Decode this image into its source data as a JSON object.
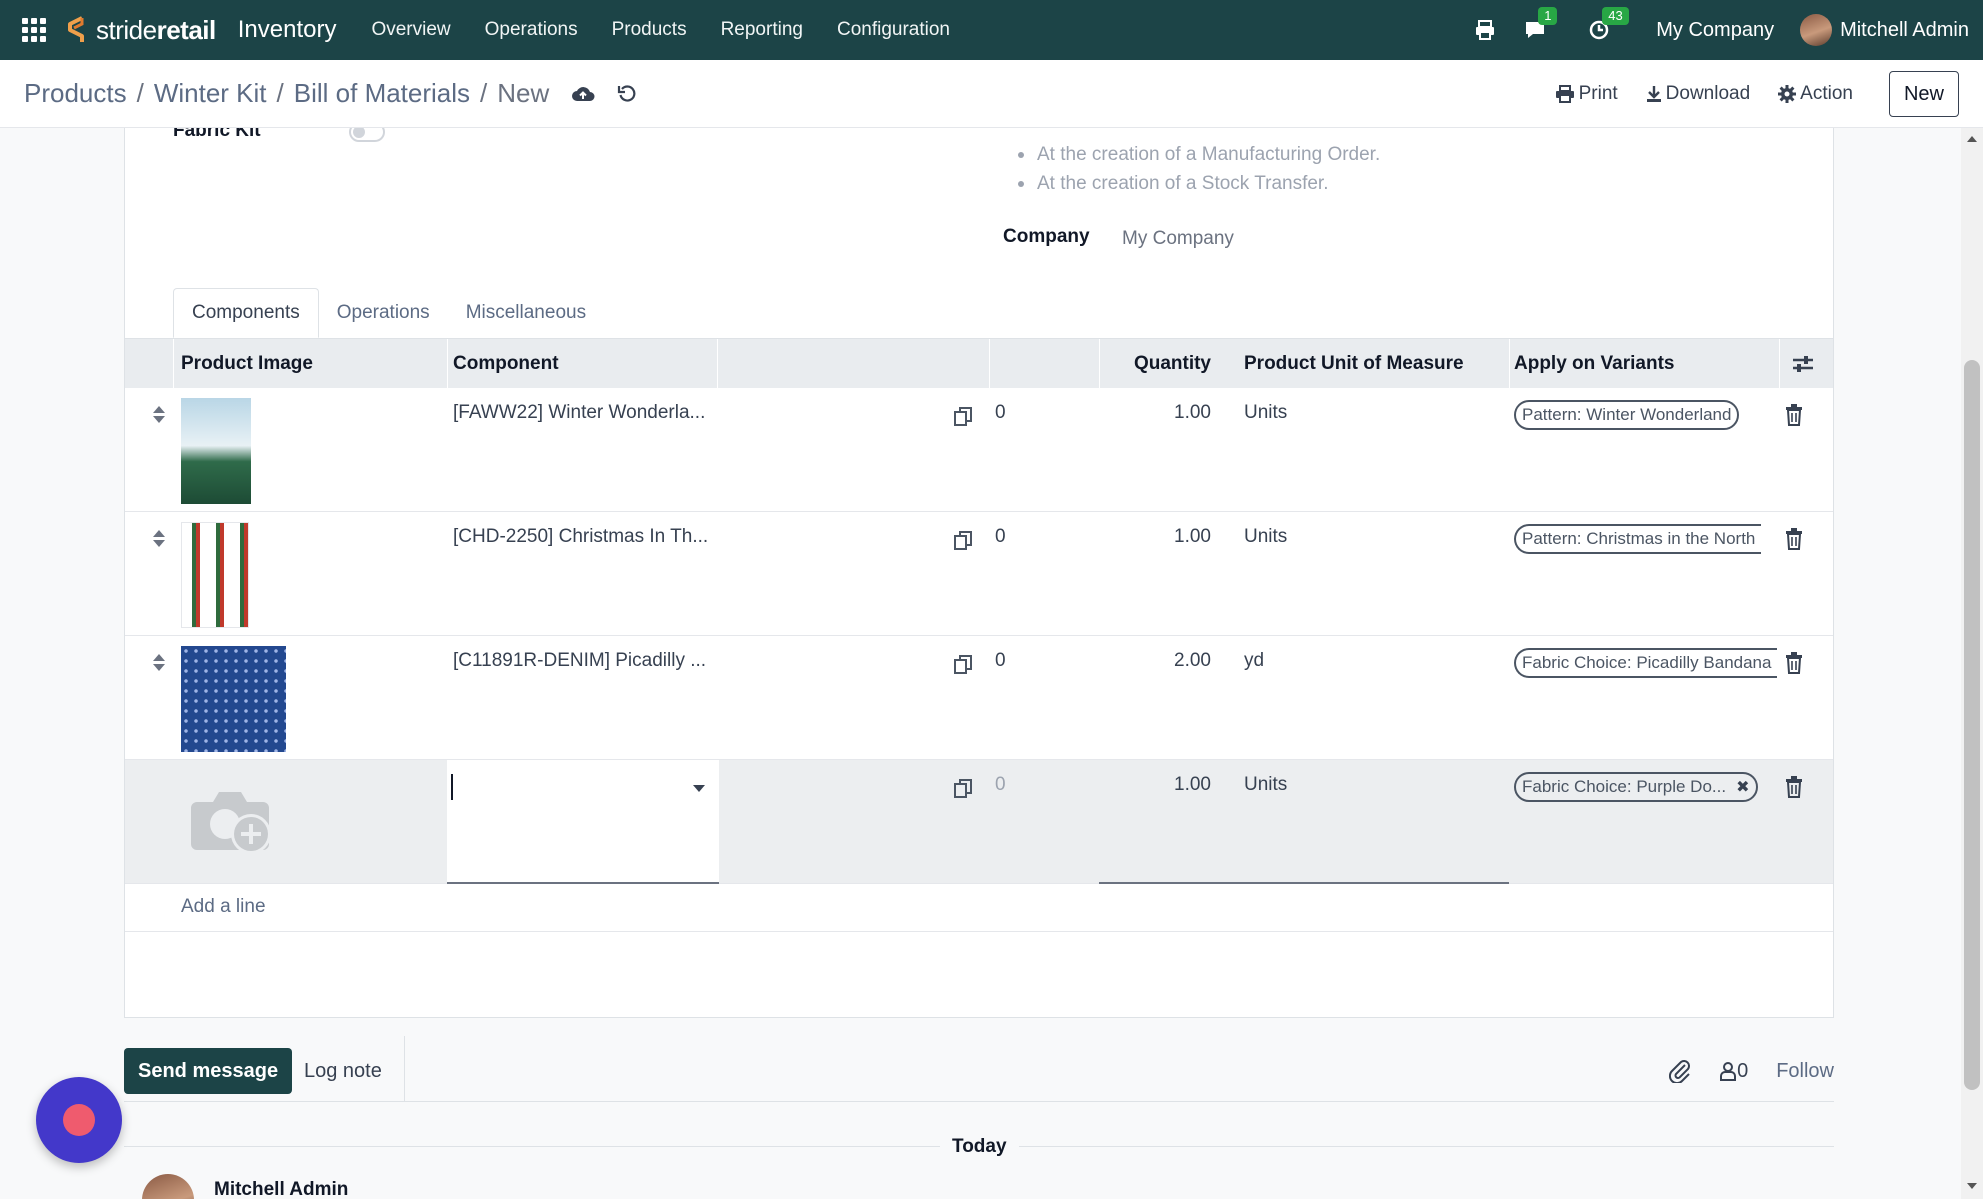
{
  "navbar": {
    "brand_light": "stride",
    "brand_bold": "retail",
    "app_name": "Inventory",
    "menu": [
      "Overview",
      "Operations",
      "Products",
      "Reporting",
      "Configuration"
    ],
    "messages_badge": "1",
    "activities_badge": "43",
    "company": "My Company",
    "user": "Mitchell Admin"
  },
  "control": {
    "breadcrumb": [
      "Products",
      "Winter Kit",
      "Bill of Materials"
    ],
    "current": "New",
    "print_label": "Print",
    "download_label": "Download",
    "action_label": "Action",
    "new_label": "New"
  },
  "form": {
    "fabric_kit_label": "Fabric Kit",
    "bullets": [
      "At the creation of a Manufacturing Order.",
      "At the creation of a Stock Transfer."
    ],
    "company_label": "Company",
    "company_value": "My Company"
  },
  "tabs": [
    {
      "label": "Components",
      "active": true
    },
    {
      "label": "Operations",
      "active": false
    },
    {
      "label": "Miscellaneous",
      "active": false
    }
  ],
  "table": {
    "headers": {
      "image": "Product Image",
      "component": "Component",
      "quantity": "Quantity",
      "uom": "Product Unit of Measure",
      "variants": "Apply on Variants"
    },
    "rows": [
      {
        "component": "[FAWW22] Winter Wonderla...",
        "avail": "0",
        "quantity": "1.00",
        "uom": "Units",
        "variant": "Pattern: Winter Wonderland"
      },
      {
        "component": "[CHD-2250] Christmas In Th...",
        "avail": "0",
        "quantity": "1.00",
        "uom": "Units",
        "variant": "Pattern: Christmas in the North"
      },
      {
        "component": "[C11891R-DENIM] Picadilly ...",
        "avail": "0",
        "quantity": "2.00",
        "uom": "yd",
        "variant": "Fabric Choice: Picadilly Bandana"
      },
      {
        "component": "",
        "avail": "0",
        "quantity": "1.00",
        "uom": "Units",
        "variant": "Fabric Choice: Purple Do..."
      }
    ],
    "add_line": "Add a line"
  },
  "chatter": {
    "send_message": "Send message",
    "log_note": "Log note",
    "followers_count": "0",
    "follow": "Follow",
    "today": "Today",
    "author": "Mitchell Admin"
  },
  "colors": {
    "navbar": "#1c4447",
    "fab": "#4338ca",
    "badge": "#28a745"
  }
}
